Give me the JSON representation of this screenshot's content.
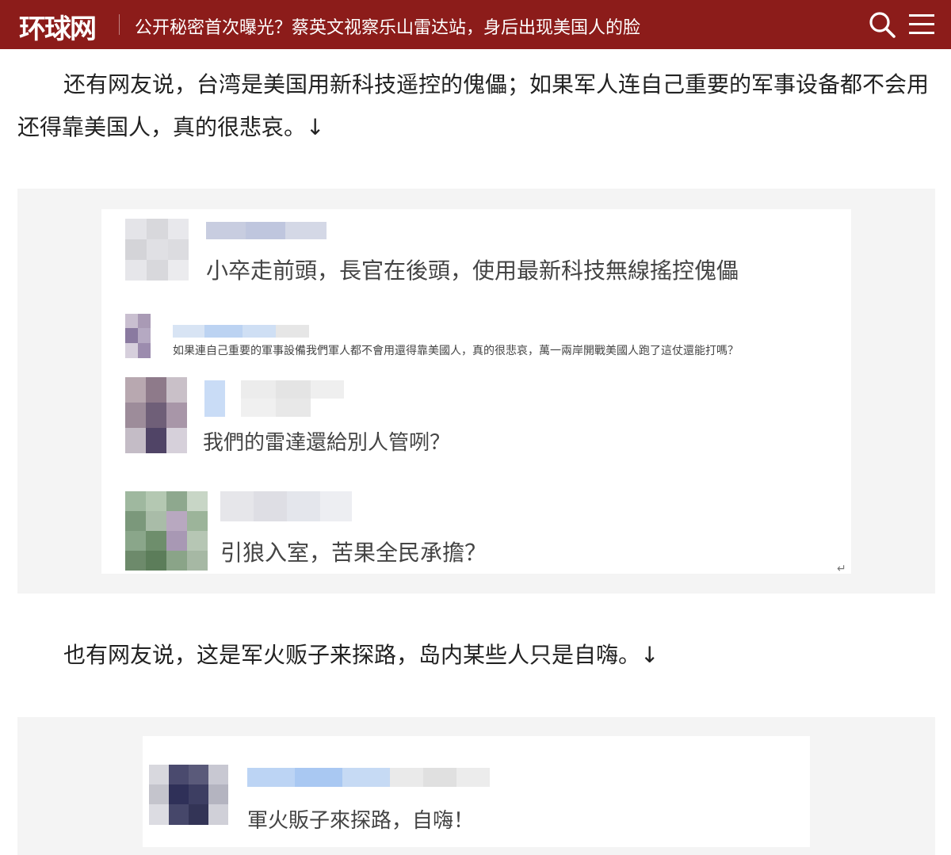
{
  "header": {
    "logo": "环球网",
    "headline": "公开秘密首次曝光？蔡英文视察乐山雷达站，身后出现美国人的脸",
    "search_icon": "search-icon",
    "menu_icon": "hamburger-menu-icon"
  },
  "article": {
    "paragraph_1": "还有网友说，台湾是美国用新科技遥控的傀儡；如果军人连自己重要的军事设备都不会用还得靠美国人，真的很悲哀。↓",
    "paragraph_2": "也有网友说，这是军火贩子来探路，岛内某些人只是自嗨。↓"
  },
  "screenshot_1": {
    "comments": [
      {
        "text": "小卒走前頭，長官在後頭，使用最新科技無線搖控傀儡"
      },
      {
        "text": "如果連自己重要的軍事設備我們軍人都不會用還得靠美國人，真的很悲哀，萬一兩岸開戰美國人跑了這仗還能打嗎？"
      },
      {
        "text": "我們的雷達還給別人管咧？"
      },
      {
        "text": "引狼入室，苦果全民承擔？"
      }
    ],
    "mark": "↵"
  },
  "screenshot_2": {
    "comments": [
      {
        "text": "軍火販子來探路，自嗨！"
      }
    ]
  },
  "colors": {
    "header_bg": "#8c1c1a",
    "frame_bg": "#f4f4f4",
    "body_text": "#222222"
  }
}
